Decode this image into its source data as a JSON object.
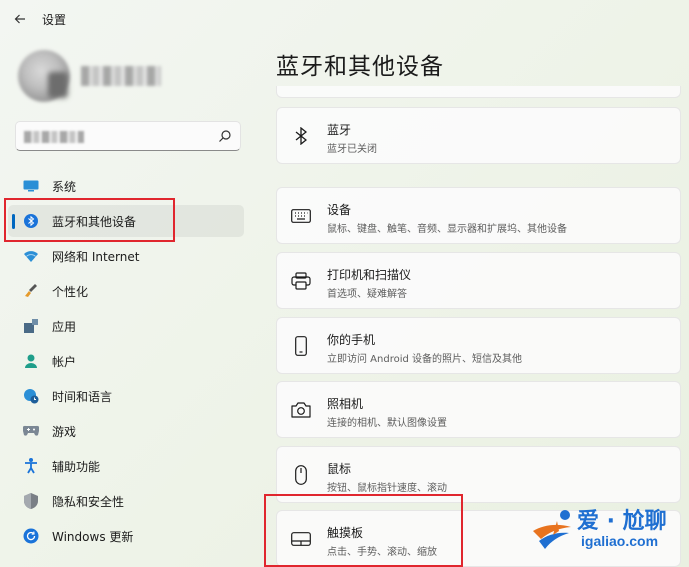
{
  "window": {
    "app_title": "设置"
  },
  "page": {
    "title": "蓝牙和其他设备"
  },
  "nav": {
    "items": [
      {
        "label": "系统",
        "icon": "display-icon"
      },
      {
        "label": "蓝牙和其他设备",
        "icon": "bluetooth-icon",
        "selected": true
      },
      {
        "label": "网络和 Internet",
        "icon": "wifi-icon"
      },
      {
        "label": "个性化",
        "icon": "brush-icon"
      },
      {
        "label": "应用",
        "icon": "apps-icon"
      },
      {
        "label": "帐户",
        "icon": "person-icon"
      },
      {
        "label": "时间和语言",
        "icon": "globe-clock-icon"
      },
      {
        "label": "游戏",
        "icon": "gamepad-icon"
      },
      {
        "label": "辅助功能",
        "icon": "accessibility-icon"
      },
      {
        "label": "隐私和安全性",
        "icon": "shield-icon"
      },
      {
        "label": "Windows 更新",
        "icon": "update-icon"
      }
    ]
  },
  "cards": [
    {
      "title": "蓝牙",
      "subtitle": "蓝牙已关闭",
      "icon": "bluetooth-icon"
    },
    {
      "title": "设备",
      "subtitle": "鼠标、键盘、触笔、音频、显示器和扩展坞、其他设备",
      "icon": "keyboard-icon"
    },
    {
      "title": "打印机和扫描仪",
      "subtitle": "首选项、疑难解答",
      "icon": "printer-icon"
    },
    {
      "title": "你的手机",
      "subtitle": "立即访问 Android 设备的照片、短信及其他",
      "icon": "phone-icon"
    },
    {
      "title": "照相机",
      "subtitle": "连接的相机、默认图像设置",
      "icon": "camera-icon"
    },
    {
      "title": "鼠标",
      "subtitle": "按钮、鼠标指针速度、滚动",
      "icon": "mouse-icon"
    },
    {
      "title": "触摸板",
      "subtitle": "点击、手势、滚动、缩放",
      "icon": "touchpad-icon"
    }
  ],
  "watermark": {
    "text": "爱 · 尬聊",
    "url": "igaliao.com"
  },
  "colors": {
    "accent": "#0067c0",
    "annotation_red": "#e0262e",
    "watermark_blue": "#1f6fd1"
  }
}
